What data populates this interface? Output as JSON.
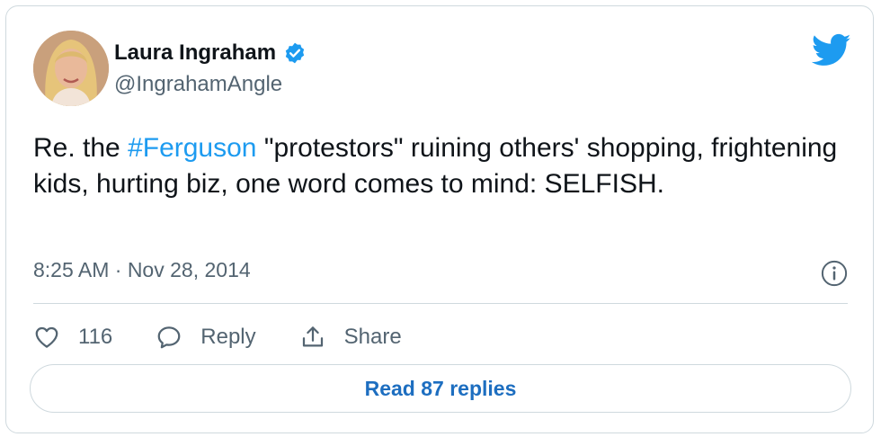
{
  "tweet": {
    "author_name": "Laura Ingraham",
    "author_handle": "@IngrahamAngle",
    "text_before": "Re. the ",
    "hashtag": "#Ferguson",
    "text_after": " \"protestors\" ruining others' shopping, frightening kids, hurting biz, one word comes to mind: SELFISH.",
    "timestamp": "8:25 AM · Nov 28, 2014",
    "like_count": "116",
    "reply_label": "Reply",
    "share_label": "Share",
    "read_replies_label": "Read 87 replies"
  },
  "icons": {
    "verified": "verified-badge-icon",
    "bird": "twitter-bird-icon",
    "info": "info-icon",
    "like": "heart-icon",
    "reply": "speech-bubble-icon",
    "share": "share-arrow-icon"
  },
  "colors": {
    "accent": "#1d9bf0",
    "link": "#1d6ec0",
    "text": "#0f1419",
    "muted": "#536471",
    "border": "#cfd9de"
  }
}
